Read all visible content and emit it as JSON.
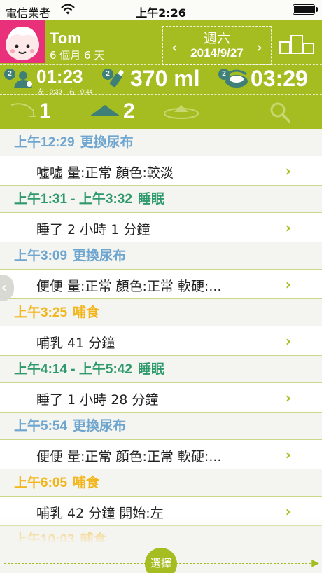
{
  "status_bar": {
    "carrier": "電信業者",
    "time": "上午2:26"
  },
  "profile": {
    "name": "Tom",
    "age": "6 個月 6 天"
  },
  "date_nav": {
    "weekday": "週六",
    "date": "2014/9/27",
    "prev": "‹",
    "next": "›"
  },
  "stats": {
    "nursing": {
      "badge": "2",
      "value": "01:23",
      "left_label": "左 - 0:39",
      "right_label": "右 - 0:44"
    },
    "bottle": {
      "badge": "2",
      "value": "370 ml"
    },
    "sleep": {
      "badge": "2",
      "value": "03:29"
    }
  },
  "filters": {
    "wet_count": "1",
    "dirty_count": "2"
  },
  "entries": [
    {
      "type": "diaper",
      "time": "上午12:29",
      "title": "更換尿布",
      "detail": "噓噓  量:正常  顏色:較淡"
    },
    {
      "type": "sleep",
      "time": "上午1:31 - 上午3:32",
      "title": "睡眠",
      "detail": "睡了 2 小時 1 分鐘"
    },
    {
      "type": "diaper",
      "time": "上午3:09",
      "title": "更換尿布",
      "detail": "便便  量:正常  顏色:正常  軟硬:..."
    },
    {
      "type": "feed",
      "time": "上午3:25",
      "title": "哺食",
      "detail": "哺乳  41 分鐘"
    },
    {
      "type": "sleep",
      "time": "上午4:14 - 上午5:42",
      "title": "睡眠",
      "detail": "睡了 1 小時 28 分鐘"
    },
    {
      "type": "diaper",
      "time": "上午5:54",
      "title": "更換尿布",
      "detail": "便便  量:正常  顏色:正常  軟硬:..."
    },
    {
      "type": "feed",
      "time": "上午6:05",
      "title": "哺食",
      "detail": "哺乳  42 分鐘 開始:左"
    },
    {
      "type": "feed",
      "time": "上午10:03",
      "title": "哺食",
      "detail": ""
    }
  ],
  "chevron": "›",
  "side_tab": "‹",
  "bottom": {
    "select_label": "選擇"
  },
  "colors": {
    "brand_green": "#a6bd21",
    "diaper": "#6fa6cf",
    "sleep": "#2e9a6b",
    "feed": "#f2b51a",
    "avatar_pink": "#e8317a"
  },
  "icons": [
    "wifi-icon",
    "battery-icon",
    "chart-icon",
    "nursing-icon",
    "bottle-icon",
    "sleep-icon",
    "wet-diaper-icon",
    "dirty-diaper-icon",
    "potty-icon",
    "search-icon"
  ]
}
